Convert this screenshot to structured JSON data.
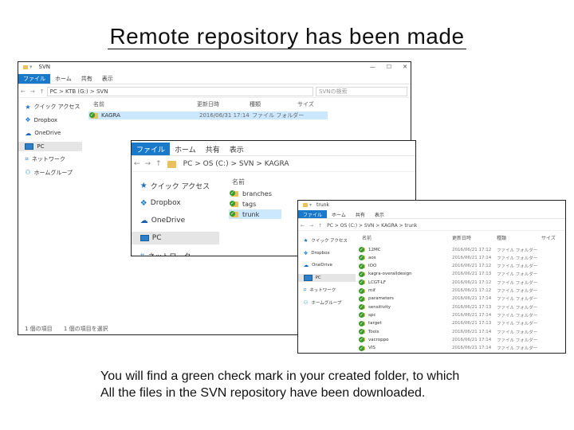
{
  "slide": {
    "title": "Remote repository has been made",
    "caption_line1": "You will find a green check mark in your created folder, to which",
    "caption_line2": "All the files in the SVN repository have been downloaded."
  },
  "colors": {
    "accent": "#1979ca",
    "folder": "#e8c15a",
    "check": "#3a9a2c",
    "selection": "#cce8ff"
  },
  "win1": {
    "title": "SVN",
    "tabs": [
      "ファイル",
      "ホーム",
      "共有",
      "表示"
    ],
    "breadcrumb": "PC > KTB (G:) > SVN",
    "search_placeholder": "SVNの検索",
    "columns": [
      "名前",
      "更新日時",
      "種類",
      "サイズ"
    ],
    "nav": [
      {
        "icon": "star-icon",
        "label": "クイック アクセス"
      },
      {
        "icon": "dropbox-icon",
        "label": "Dropbox"
      },
      {
        "icon": "onedrive-icon",
        "label": "OneDrive"
      },
      {
        "icon": "pc-icon",
        "label": "PC",
        "selected": true
      },
      {
        "icon": "network-icon",
        "label": "ネットワーク"
      },
      {
        "icon": "homegroup-icon",
        "label": "ホームグループ"
      }
    ],
    "rows": [
      {
        "name": "KAGRA",
        "date": "2016/06/31 17:14",
        "type": "ファイル フォルダー",
        "selected": true
      }
    ],
    "status_count": "1 個の項目",
    "status_selected": "1 個の項目を選択"
  },
  "win2": {
    "tabs": [
      "ファイル",
      "ホーム",
      "共有",
      "表示"
    ],
    "breadcrumb": "PC  >  OS (C:)  >  SVN  >  KAGRA",
    "column_name": "名前",
    "nav": [
      {
        "icon": "star-icon",
        "label": "クイック アクセス"
      },
      {
        "icon": "dropbox-icon",
        "label": "Dropbox"
      },
      {
        "icon": "onedrive-icon",
        "label": "OneDrive"
      },
      {
        "icon": "pc-icon",
        "label": "PC",
        "selected": true
      },
      {
        "icon": "network-icon",
        "label": "ネットワーク"
      }
    ],
    "rows": [
      {
        "name": "branches"
      },
      {
        "name": "tags"
      },
      {
        "name": "trunk",
        "selected": true
      }
    ]
  },
  "win3": {
    "title": "trunk",
    "tabs": [
      "ファイル",
      "ホーム",
      "共有",
      "表示"
    ],
    "breadcrumb": "PC > OS (C:) > SVN > KAGRA > trunk",
    "columns": [
      "名前",
      "更新日時",
      "種類",
      "サイズ"
    ],
    "nav": [
      {
        "icon": "star-icon",
        "label": "クイック アクセス"
      },
      {
        "icon": "dropbox-icon",
        "label": "Dropbox"
      },
      {
        "icon": "onedrive-icon",
        "label": "OneDrive"
      },
      {
        "icon": "pc-icon",
        "label": "PC",
        "selected": true
      },
      {
        "icon": "network-icon",
        "label": "ネットワーク"
      },
      {
        "icon": "homegroup-icon",
        "label": "ホームグループ"
      }
    ],
    "rows": [
      {
        "name": "12MC",
        "date": "2016/06/21 17:12",
        "type": "ファイル フォルダー"
      },
      {
        "name": "aos",
        "date": "2016/06/21 17:14",
        "type": "ファイル フォルダー"
      },
      {
        "name": "IOO",
        "date": "2016/06/21 17:12",
        "type": "ファイル フォルダー"
      },
      {
        "name": "kagra-overalldesign",
        "date": "2016/06/21 17:13",
        "type": "ファイル フォルダー"
      },
      {
        "name": "LCGT-LF",
        "date": "2016/06/21 17:12",
        "type": "ファイル フォルダー"
      },
      {
        "name": "mif",
        "date": "2016/06/21 17:12",
        "type": "ファイル フォルダー"
      },
      {
        "name": "parameters",
        "date": "2016/06/21 17:14",
        "type": "ファイル フォルダー"
      },
      {
        "name": "sensitivity",
        "date": "2016/06/21 17:13",
        "type": "ファイル フォルダー"
      },
      {
        "name": "spc",
        "date": "2016/06/21 17:14",
        "type": "ファイル フォルダー"
      },
      {
        "name": "target",
        "date": "2016/06/21 17:13",
        "type": "ファイル フォルダー"
      },
      {
        "name": "Tools",
        "date": "2016/06/21 17:14",
        "type": "ファイル フォルダー"
      },
      {
        "name": "vacroppo",
        "date": "2016/06/21 17:14",
        "type": "ファイル フォルダー"
      },
      {
        "name": "VIS",
        "date": "2016/06/21 17:14",
        "type": "ファイル フォルダー"
      }
    ]
  }
}
